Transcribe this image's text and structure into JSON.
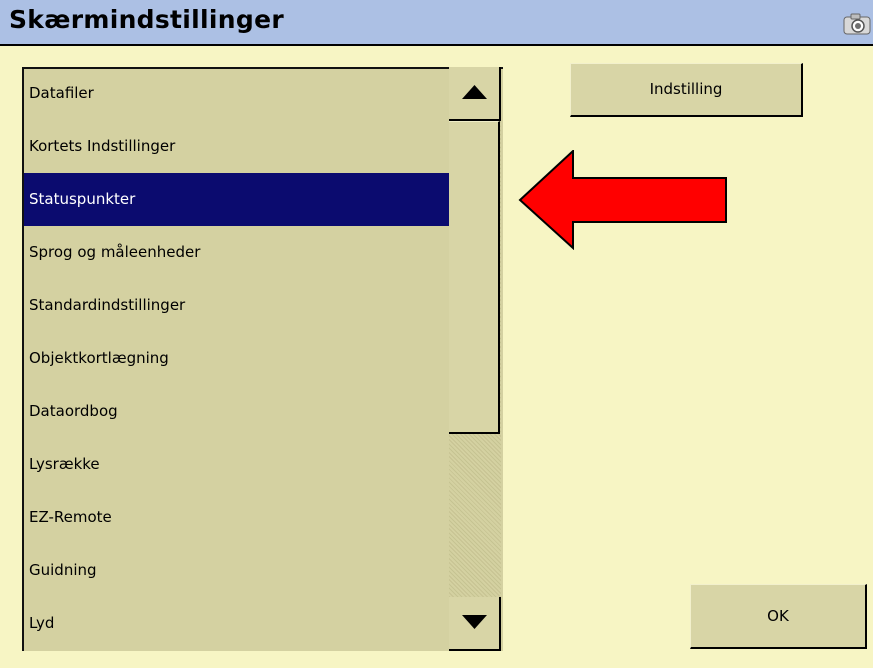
{
  "window": {
    "title": "Skærmindstillinger"
  },
  "list": {
    "items": [
      {
        "label": "Datafiler"
      },
      {
        "label": "Kortets Indstillinger"
      },
      {
        "label": "Statuspunkter",
        "selected": true
      },
      {
        "label": "Sprog og måleenheder"
      },
      {
        "label": "Standardindstillinger"
      },
      {
        "label": "Objektkortlægning"
      },
      {
        "label": "Dataordbog"
      },
      {
        "label": "Lysrække"
      },
      {
        "label": "EZ-Remote"
      },
      {
        "label": "Guidning"
      },
      {
        "label": "Lyd"
      }
    ]
  },
  "buttons": {
    "settings_label": "Indstilling",
    "ok_label": "OK"
  },
  "icons": {
    "camera": "camera-icon",
    "scroll_up": "triangle-up-icon",
    "scroll_down": "triangle-down-icon",
    "pointer_arrow": "red-left-arrow-icon"
  },
  "colors": {
    "background": "#f7f5c4",
    "titlebar": "#acc0e4",
    "list_background": "#d4d1a1",
    "selection": "#0b0b6f",
    "arrow": "#ff0000"
  }
}
